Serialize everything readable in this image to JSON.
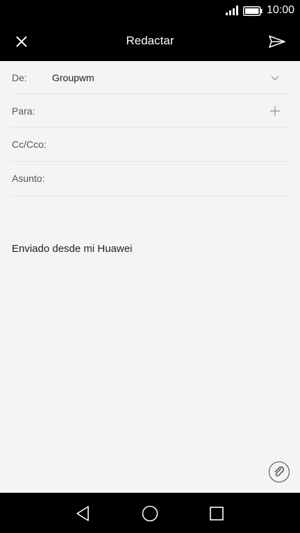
{
  "status_bar": {
    "time": "10:00"
  },
  "app_bar": {
    "title": "Redactar",
    "close_icon": "close-icon",
    "send_icon": "send-icon"
  },
  "compose": {
    "from": {
      "label": "De:",
      "value": "Groupwm"
    },
    "to": {
      "label": "Para:",
      "value": ""
    },
    "cc": {
      "label": "Cc/Cco:",
      "value": ""
    },
    "subject": {
      "label": "Asunto:",
      "value": ""
    },
    "body_signature": "Enviado desde mi Huawei"
  },
  "nav_bar": {
    "back_icon": "back-icon",
    "home_icon": "home-icon",
    "recents_icon": "recents-icon"
  },
  "colors": {
    "bar_background": "#000000",
    "screen_background": "#f4f4f4",
    "divider": "#e3e3e3"
  }
}
